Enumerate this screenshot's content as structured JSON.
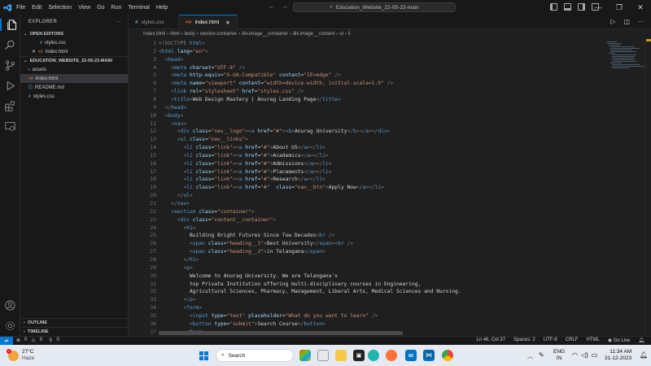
{
  "titlebar": {
    "menu": [
      "File",
      "Edit",
      "Selection",
      "View",
      "Go",
      "Run",
      "Terminal",
      "Help"
    ],
    "search": "Education_Website_22-05-23-main"
  },
  "sidebar": {
    "title": "EXPLORER",
    "open_editors_label": "OPEN EDITORS",
    "open_editors": [
      {
        "name": "styles.css",
        "badge": "#",
        "badge_color": "#519aba",
        "close": false
      },
      {
        "name": "index.html",
        "badge": "<>",
        "badge_color": "#e37933",
        "close": true
      }
    ],
    "project_label": "EDUCATION_WEBSITE_22-05-23-MAIN",
    "files": [
      {
        "name": "assets",
        "kind": "folder",
        "badge": "›",
        "badge_color": "#ccc"
      },
      {
        "name": "index.html",
        "kind": "file",
        "badge": "<>",
        "badge_color": "#e37933",
        "selected": true
      },
      {
        "name": "README.md",
        "kind": "file",
        "badge": "ⓘ",
        "badge_color": "#519aba"
      },
      {
        "name": "styles.css",
        "kind": "file",
        "badge": "#",
        "badge_color": "#519aba"
      }
    ],
    "outline_label": "OUTLINE",
    "timeline_label": "TIMELINE"
  },
  "tabs": [
    {
      "name": "styles.css",
      "badge": "#",
      "badge_color": "#519aba",
      "active": false
    },
    {
      "name": "index.html",
      "badge": "<>",
      "badge_color": "#e37933",
      "active": true
    }
  ],
  "breadcrumb": [
    "index.html",
    "html",
    "body",
    "section.container",
    "div.image__container",
    "div.image__content",
    "ul",
    "li"
  ],
  "editor": {
    "lines": [
      {
        "n": "1",
        "c": "<p>&lt;!DOCTYPE <t>html</t>&gt;</p>",
        "i": 0
      },
      {
        "n": "2",
        "c": "<p>&lt;</p><t>html</t> <a>lang</a>=<s>\"en\"</s><p>&gt;</p>",
        "i": 0
      },
      {
        "n": "3",
        "c": "<p>&lt;</p><t>head</t><p>&gt;</p>",
        "i": 1
      },
      {
        "n": "4",
        "c": "<p>&lt;</p><t>meta</t> <a>charset</a>=<s>\"UTF-8\"</s> <p>/&gt;</p>",
        "i": 2
      },
      {
        "n": "5",
        "c": "<p>&lt;</p><t>meta</t> <a>http-equiv</a>=<s>\"X-UA-Compatible\"</s> <a>content</a>=<s>\"IE=edge\"</s> <p>/&gt;</p>",
        "i": 2
      },
      {
        "n": "6",
        "c": "<p>&lt;</p><t>meta</t> <a>name</a>=<s>\"viewport\"</s> <a>content</a>=<s>\"width=device-width, initial-scale=1.0\"</s> <p>/&gt;</p>",
        "i": 2
      },
      {
        "n": "7",
        "c": "<p>&lt;</p><t>link</t> <a>rel</a>=<s>\"stylesheet\"</s> <a>href</a>=<s>\"styles.css\"</s> <p>/&gt;</p>",
        "i": 2
      },
      {
        "n": "8",
        "c": "<p>&lt;</p><t>title</t><p>&gt;</p>Web Design Mastery | Anurag Landing Page<p>&lt;/</p><t>title</t><p>&gt;</p>",
        "i": 2
      },
      {
        "n": "9",
        "c": "<p>&lt;/</p><t>head</t><p>&gt;</p>",
        "i": 1
      },
      {
        "n": "10",
        "c": "<p>&lt;</p><t>body</t><p>&gt;</p>",
        "i": 1
      },
      {
        "n": "11",
        "c": "<p>&lt;</p><t>nav</t><p>&gt;</p>",
        "i": 2
      },
      {
        "n": "12",
        "c": "<p>&lt;</p><t>div</t> <a>class</a>=<s>\"nav__logo\"</s><p>&gt;&lt;</p><t>a</t> <a>href</a>=<s>\"#\"</s><p>&gt;&lt;</p><t>b</t><p>&gt;</p>Anurag University<p>&lt;/</p><t>b</t><p>&gt;&lt;/</p><t>a</t><p>&gt;&lt;/</p><t>div</t><p>&gt;</p>",
        "i": 3
      },
      {
        "n": "13",
        "c": "<p>&lt;</p><t>ul</t> <a>class</a>=<s>\"nav__links\"</s><p>&gt;</p>",
        "i": 3
      },
      {
        "n": "14",
        "c": "<p>&lt;</p><t>li</t> <a>class</a>=<s>\"link\"</s><p>&gt;&lt;</p><t>a</t> <a>href</a>=<s>\"#\"</s><p>&gt;</p>About US<p>&lt;/</p><t>a</t><p>&gt;&lt;/</p><t>li</t><p>&gt;</p>",
        "i": 4
      },
      {
        "n": "15",
        "c": "<p>&lt;</p><t>li</t> <a>class</a>=<s>\"link\"</s><p>&gt;&lt;</p><t>a</t> <a>href</a>=<s>\"#\"</s><p>&gt;</p>Academics<p>&lt;/</p><t>a</t><p>&gt;&lt;/</p><t>li</t><p>&gt;</p>",
        "i": 4
      },
      {
        "n": "16",
        "c": "<p>&lt;</p><t>li</t> <a>class</a>=<s>\"link\"</s><p>&gt;&lt;</p><t>a</t> <a>href</a>=<s>\"#\"</s><p>&gt;</p>Admissions<p>&lt;/</p><t>a</t><p>&gt;&lt;/</p><t>li</t><p>&gt;</p>",
        "i": 4
      },
      {
        "n": "17",
        "c": "<p>&lt;</p><t>li</t> <a>class</a>=<s>\"link\"</s><p>&gt;&lt;</p><t>a</t> <a>href</a>=<s>\"#\"</s><p>&gt;</p>Placements<p>&lt;/</p><t>a</t><p>&gt;&lt;/</p><t>li</t><p>&gt;</p>",
        "i": 4
      },
      {
        "n": "18",
        "c": "<p>&lt;</p><t>li</t> <a>class</a>=<s>\"link\"</s><p>&gt;&lt;</p><t>a</t> <a>href</a>=<s>\"#\"</s><p>&gt;</p>Research<p>&lt;/</p><t>a</t><p>&gt;&lt;/</p><t>li</t><p>&gt;</p>",
        "i": 4
      },
      {
        "n": "19",
        "c": "<p>&lt;</p><t>li</t> <a>class</a>=<s>\"link\"</s><p>&gt;&lt;</p><t>a</t> <a>href</a>=<s>\"#\"</s>  <a>class</a>=<s>\"nav__btn\"</s><p>&gt;</p>Apply Now<p>&lt;/</p><t>a</t><p>&gt;&lt;/</p><t>li</t><p>&gt;</p>",
        "i": 4
      },
      {
        "n": "20",
        "c": "<p>&lt;/</p><t>ul</t><p>&gt;</p>",
        "i": 3
      },
      {
        "n": "21",
        "c": "<p>&lt;/</p><t>nav</t><p>&gt;</p>",
        "i": 2
      },
      {
        "n": "22",
        "c": "<p>&lt;</p><t>section</t> <a>class</a>=<s>\"container\"</s><p>&gt;</p>",
        "i": 2
      },
      {
        "n": "23",
        "c": "<p>&lt;</p><t>div</t> <a>class</a>=<s>\"content__container\"</s><p>&gt;</p>",
        "i": 3
      },
      {
        "n": "24",
        "c": "<p>&lt;</p><t>h1</t><p>&gt;</p>",
        "i": 4
      },
      {
        "n": "25",
        "c": "Building Bright Futures Since Tow Decades<p>&lt;</p><t>br</t> <p>/&gt;</p>",
        "i": 5
      },
      {
        "n": "26",
        "c": "<p>&lt;</p><t>span</t> <a>class</a>=<s>\"heading__1\"</s><p>&gt;</p>Best University<p>&lt;/</p><t>span</t><p>&gt;&lt;</p><t>br</t> <p>/&gt;</p>",
        "i": 5
      },
      {
        "n": "27",
        "c": "<p>&lt;</p><t>span</t> <a>class</a>=<s>\"heading__2\"</s><p>&gt;</p>in Telangana<p>&lt;/</p><t>span</t><p>&gt;</p>",
        "i": 5
      },
      {
        "n": "28",
        "c": "<p>&lt;/</p><t>h1</t><p>&gt;</p>",
        "i": 4
      },
      {
        "n": "29",
        "c": "<p>&lt;</p><t>p</t><p>&gt;</p>",
        "i": 4
      },
      {
        "n": "30",
        "c": "Welcome to Anurag University. We are Telangana's",
        "i": 5
      },
      {
        "n": "31",
        "c": "top Private Institution offering multi-disciplinary courses in Engineering,",
        "i": 5
      },
      {
        "n": "32",
        "c": "Agricultural Sciences, Pharmacy, Management, Liberal Arts, Medical Sciences and Nursing.",
        "i": 5
      },
      {
        "n": "33",
        "c": "<p>&lt;/</p><t>p</t><p>&gt;</p>",
        "i": 4
      },
      {
        "n": "34",
        "c": "<p>&lt;</p><t>form</t><p>&gt;</p>",
        "i": 4
      },
      {
        "n": "35",
        "c": "<p>&lt;</p><t>input</t> <a>type</a>=<s>\"text\"</s> <a>placeholder</a>=<s>\"What do you want to learn\"</s> <p>/&gt;</p>",
        "i": 5
      },
      {
        "n": "36",
        "c": "<p>&lt;</p><t>button</t> <a>type</a>=<s>\"submit\"</s><p>&gt;</p>Search Course<p>&lt;/</p><t>button</t><p>&gt;</p>",
        "i": 5
      },
      {
        "n": "37",
        "c": "<p>&lt;/</p><t>form</t><p>&gt;</p>",
        "i": 4
      }
    ]
  },
  "status": {
    "errors": "0",
    "warnings": "0",
    "ports": "0",
    "position": "Ln 46, Col 37",
    "spaces": "Spaces: 2",
    "encoding": "UTF-8",
    "eol": "CRLF",
    "language": "HTML",
    "golive": "Go Live"
  },
  "taskbar": {
    "weather_temp": "27°C",
    "weather_desc": "Haze",
    "search": "Search",
    "lang_top": "ENG",
    "lang_bottom": "IN",
    "time": "11:34 AM",
    "date": "31-12-2023"
  },
  "colors": {
    "accent": "#0078d4",
    "editor_bg": "#1f1f1f",
    "sidebar_bg": "#181818"
  }
}
